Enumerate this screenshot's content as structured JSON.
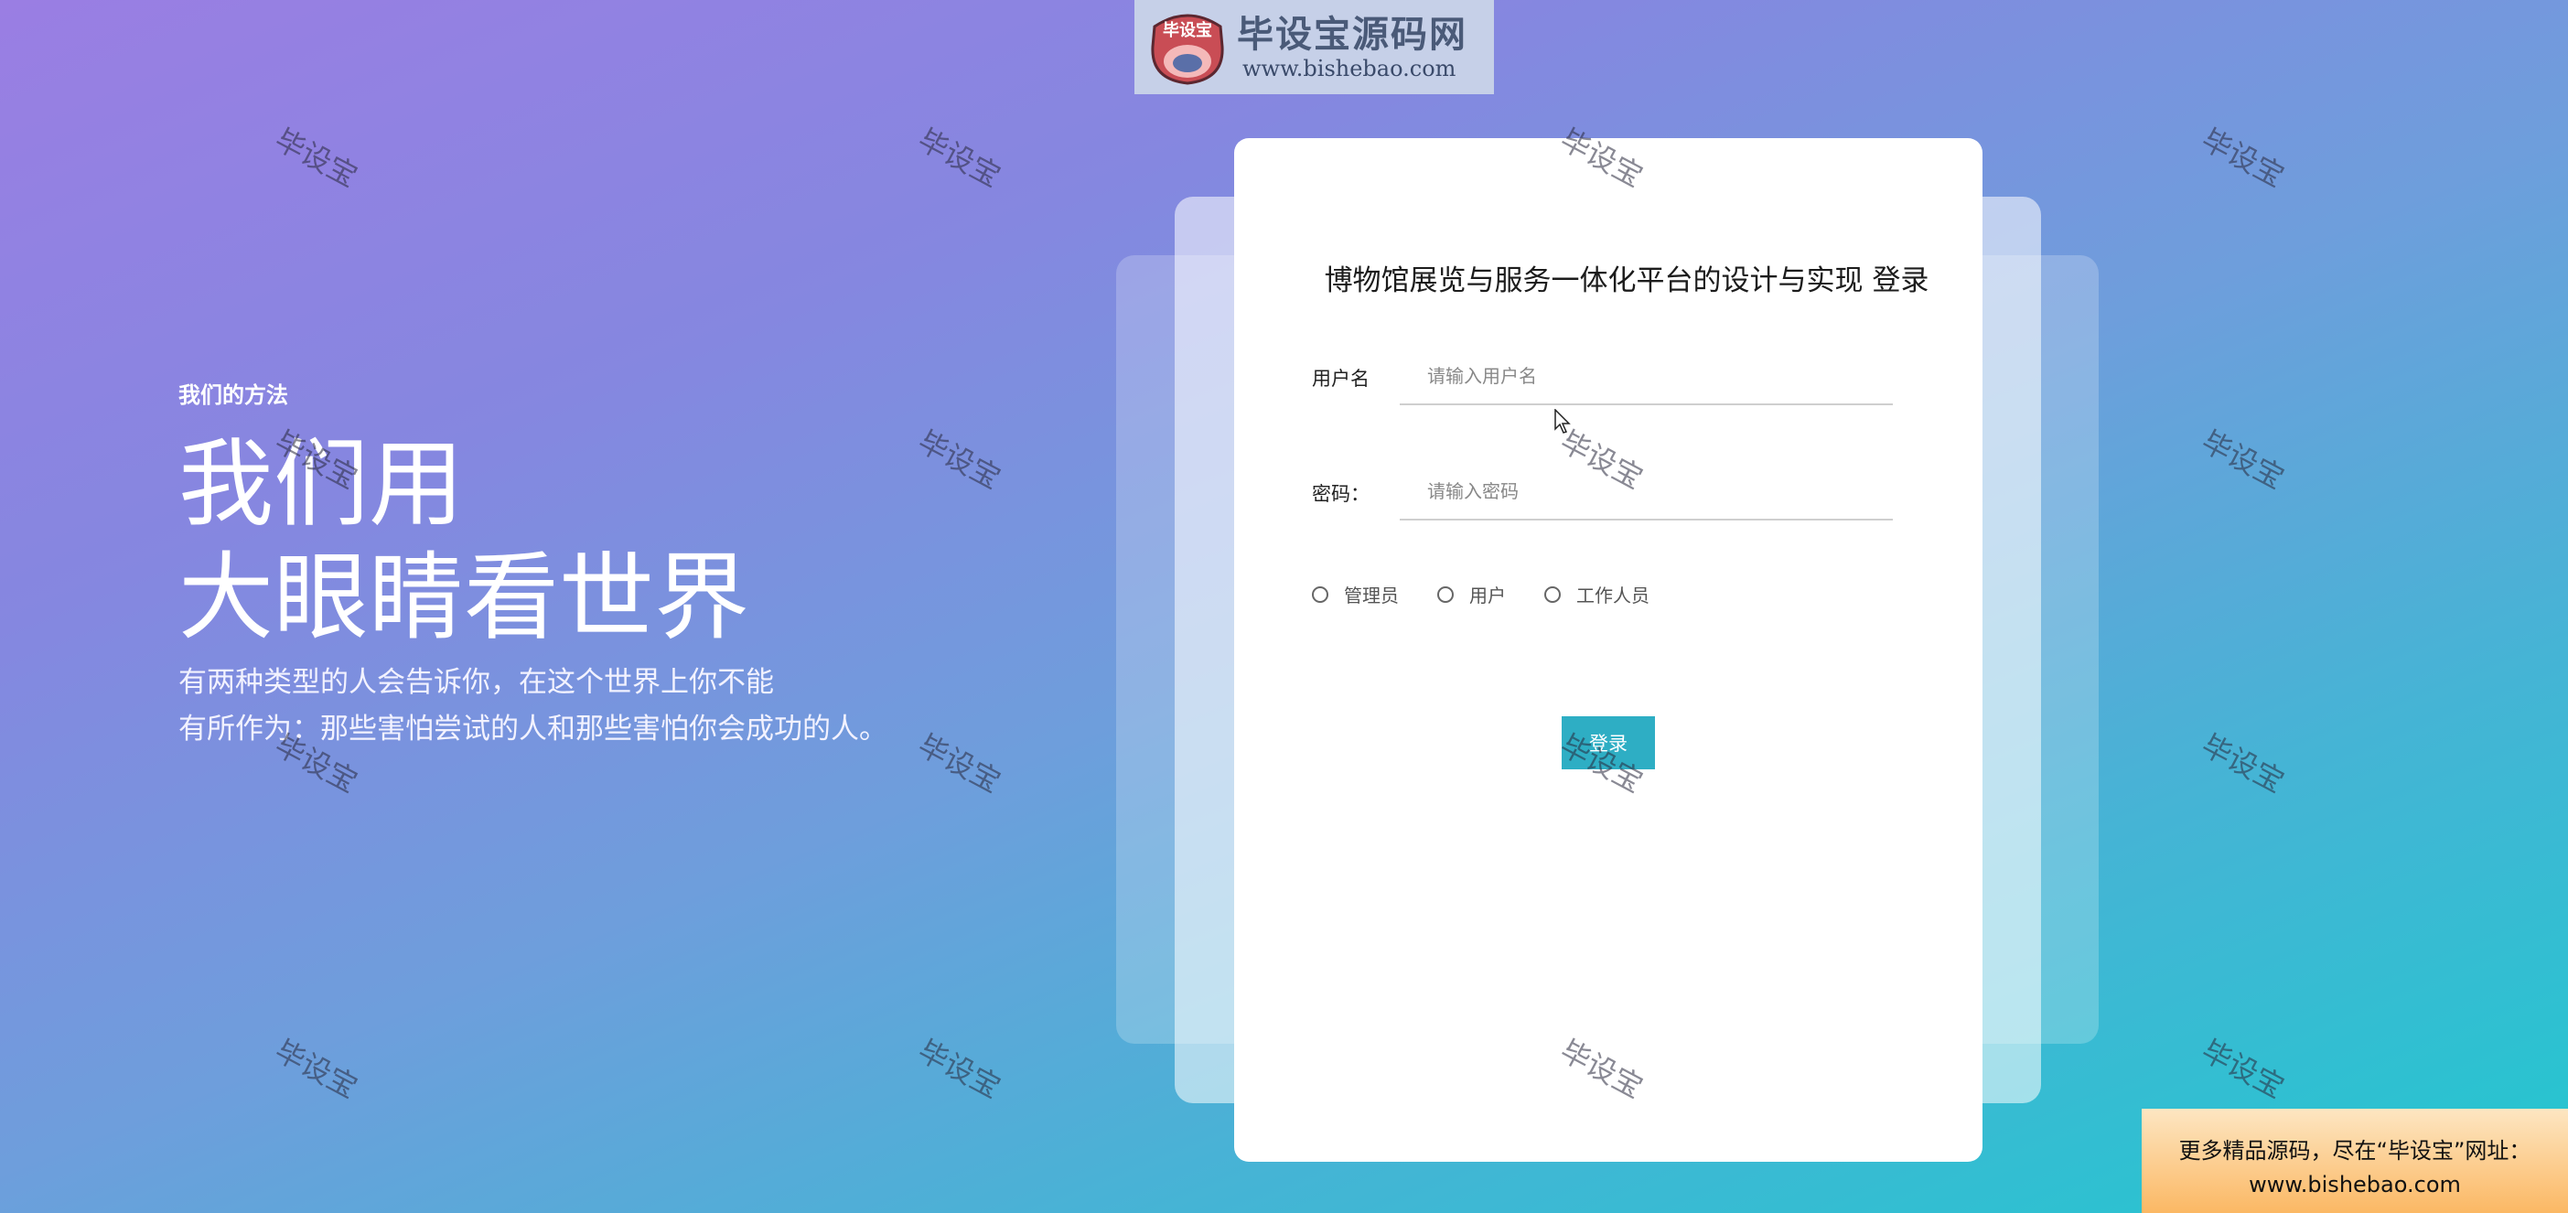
{
  "logo": {
    "badge_text": "毕设宝",
    "site_name": "毕设宝源码网",
    "site_url": "www.bishebao.com"
  },
  "hero": {
    "kicker": "我们的方法",
    "title_line1": "我们用",
    "title_line2": "大眼睛看世界",
    "desc_line1": "有两种类型的人会告诉你，在这个世界上你不能",
    "desc_line2": "有所作为：那些害怕尝试的人和那些害怕你会成功的人。"
  },
  "login": {
    "title": "博物馆展览与服务一体化平台的设计与实现 登录",
    "username_label": "用户名",
    "username_placeholder": "请输入用户名",
    "password_label": "密码：",
    "password_placeholder": "请输入密码",
    "roles": [
      "管理员",
      "用户",
      "工作人员"
    ],
    "submit_label": "登录"
  },
  "watermark_text": "毕设宝",
  "ad": {
    "line1": "更多精品源码，尽在“毕设宝”网址：",
    "line2": "www.bishebao.com"
  },
  "colors": {
    "button": "#2eaec4",
    "gradient_start": "#9a7ee3",
    "gradient_end": "#22c7cf"
  }
}
